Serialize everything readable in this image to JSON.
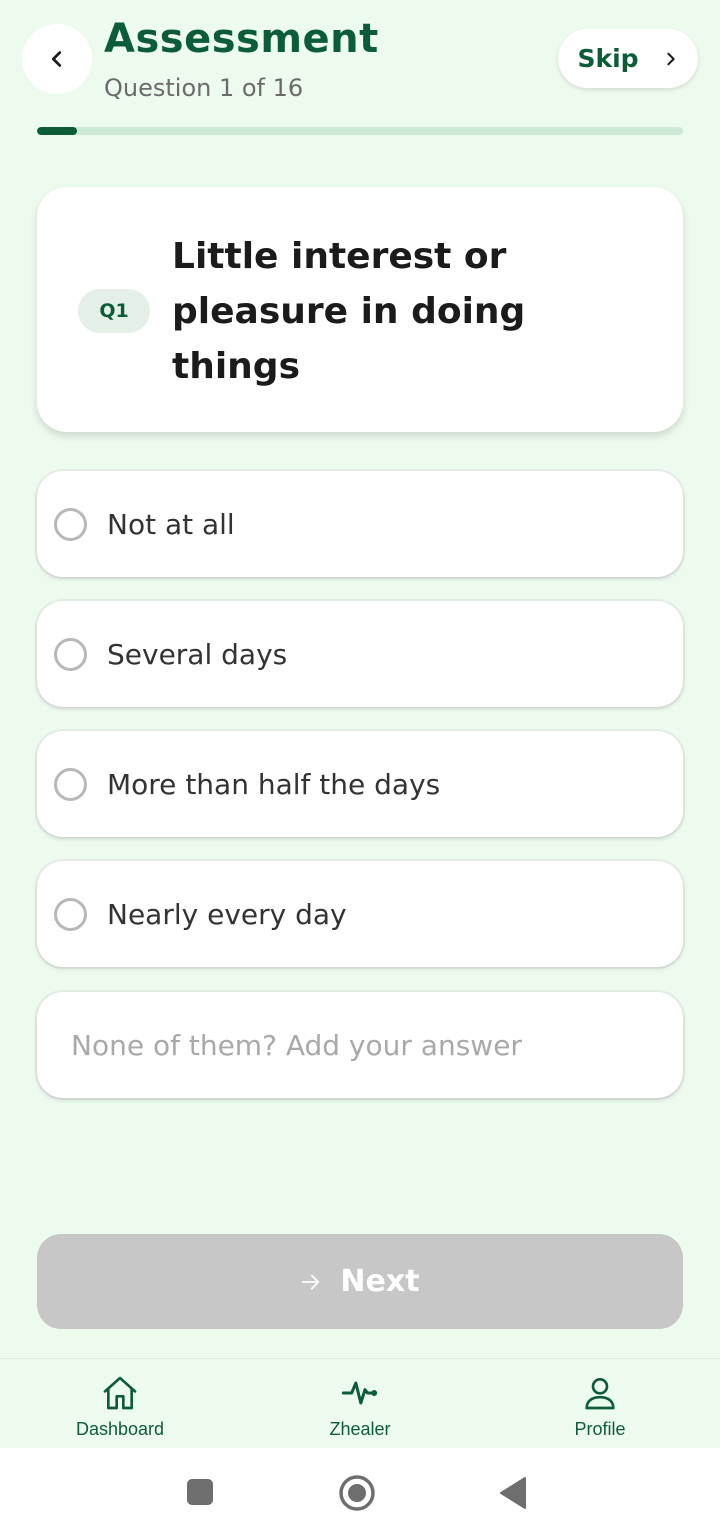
{
  "header": {
    "title": "Assessment",
    "subtitle": "Question 1 of 16",
    "skip_label": "Skip"
  },
  "progress": {
    "current": 1,
    "total": 16,
    "fraction": 0.0625
  },
  "question": {
    "badge": "Q1",
    "text": "Little interest or pleasure in doing things"
  },
  "options": [
    {
      "label": "Not at all",
      "selected": false
    },
    {
      "label": "Several days",
      "selected": false
    },
    {
      "label": "More than half the days",
      "selected": false
    },
    {
      "label": "Nearly every day",
      "selected": false
    }
  ],
  "custom_answer": {
    "placeholder": "None of them? Add your answer",
    "value": ""
  },
  "next_button": {
    "label": "Next",
    "enabled": false
  },
  "bottom_nav": [
    {
      "label": "Dashboard",
      "icon": "home-icon"
    },
    {
      "label": "Zhealer",
      "icon": "activity-icon"
    },
    {
      "label": "Profile",
      "icon": "person-icon"
    }
  ],
  "colors": {
    "background": "#edfbef",
    "brand": "#0d5c38",
    "disabled_button": "#c7c7c7"
  }
}
